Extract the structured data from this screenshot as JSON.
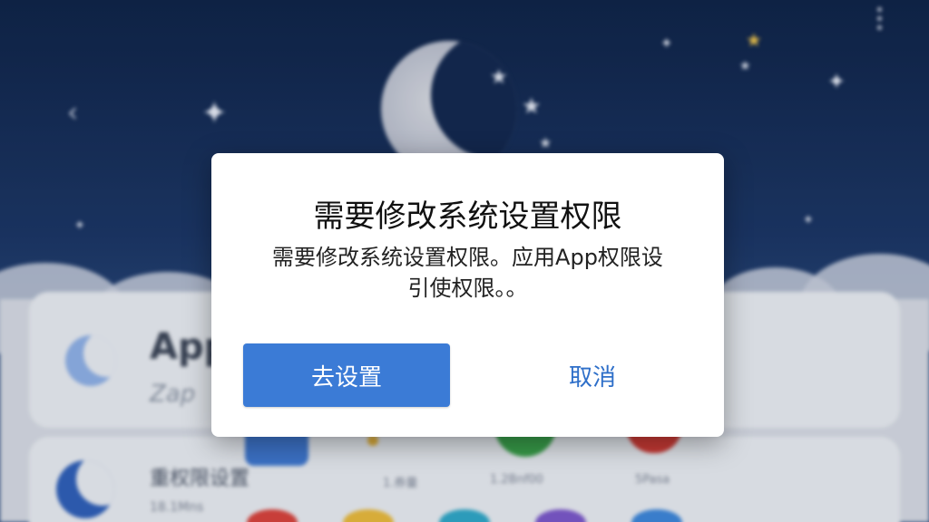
{
  "background": {
    "card_title": "App",
    "card_subtitle": "Zap",
    "card2_title": "重权限设置",
    "card2_subtitle": "18.1Mns",
    "app_labels": [
      "1.券量",
      "1.2Bnf00",
      "5Pasa"
    ]
  },
  "dialog": {
    "title": "需要修改系统设置权限",
    "body_line1": "需要修改系统设置权限。应用App权限设",
    "body_line2": "引使权限。。",
    "confirm_label": "去设置",
    "cancel_label": "取消"
  },
  "colors": {
    "primary": "#3b7bd6",
    "link": "#2e6fc9",
    "night_sky": "#1b3564"
  }
}
